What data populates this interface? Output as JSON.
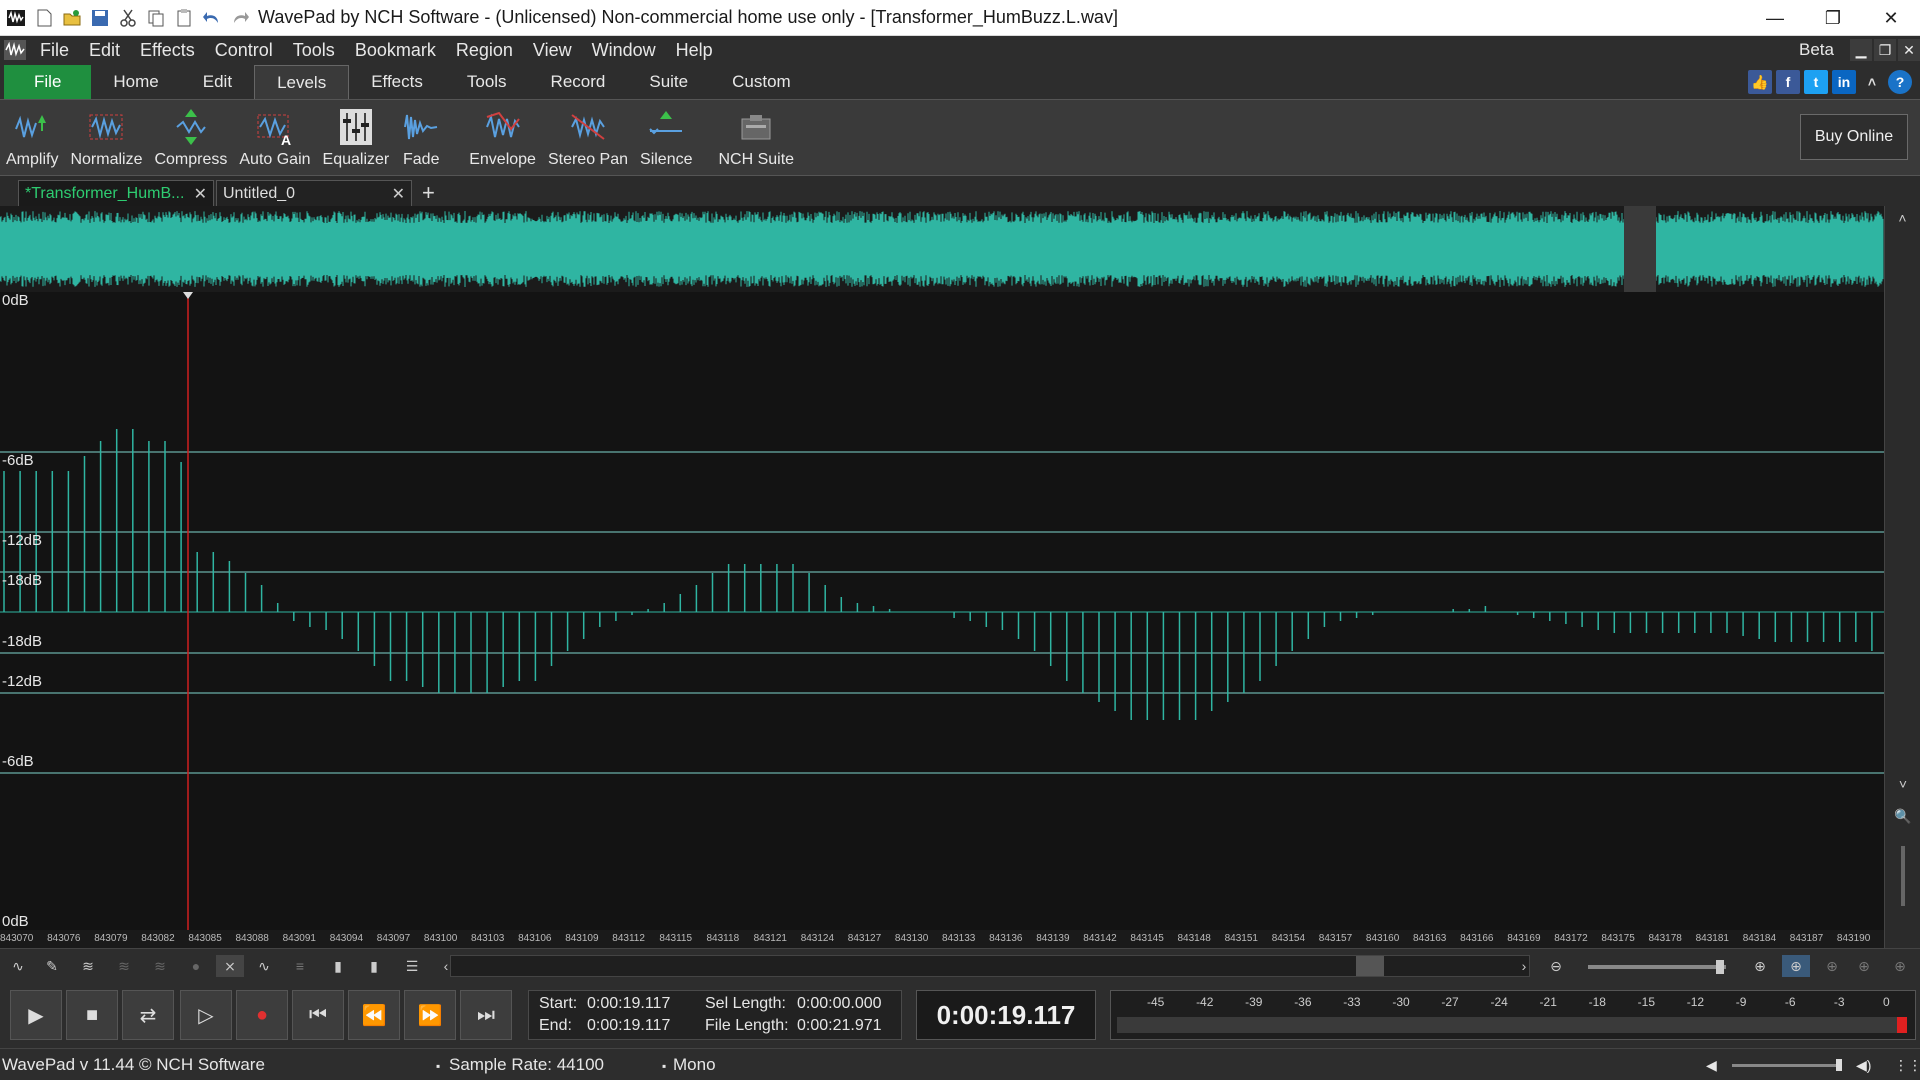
{
  "window": {
    "title": "WavePad by NCH Software - (Unlicensed) Non-commercial home use only - [Transformer_HumBuzz.L.wav]",
    "minimize": "—",
    "restore": "❐",
    "close": "✕"
  },
  "menu": {
    "items": [
      "File",
      "Edit",
      "Effects",
      "Control",
      "Tools",
      "Bookmark",
      "Region",
      "View",
      "Window",
      "Help"
    ],
    "beta": "Beta"
  },
  "ribbon_tabs": [
    "File",
    "Home",
    "Edit",
    "Levels",
    "Effects",
    "Tools",
    "Record",
    "Suite",
    "Custom"
  ],
  "active_ribbon_tab": "Levels",
  "toolbar": {
    "tools": [
      "Amplify",
      "Normalize",
      "Compress",
      "Auto Gain",
      "Equalizer",
      "Fade",
      "Envelope",
      "Stereo Pan",
      "Silence",
      "NCH Suite"
    ],
    "buy_online": "Buy Online"
  },
  "doc_tabs": [
    {
      "label": "*Transformer_HumB...",
      "active": true
    },
    {
      "label": "Untitled_0",
      "active": false
    }
  ],
  "db_labels": [
    "0dB",
    "-6dB",
    "-12dB",
    "-18dB",
    "-18dB",
    "-12dB",
    "-6dB",
    "0dB"
  ],
  "ruler_ticks": [
    "843070",
    "843076",
    "843079",
    "843082",
    "843085",
    "843088",
    "843091",
    "843094",
    "843097",
    "843100",
    "843103",
    "843106",
    "843109",
    "843112",
    "843115",
    "843118",
    "843121",
    "843124",
    "843127",
    "843130",
    "843133",
    "843136",
    "843139",
    "843142",
    "843145",
    "843148",
    "843151",
    "843154",
    "843157",
    "843160",
    "843163",
    "843166",
    "843169",
    "843172",
    "843175",
    "843178",
    "843181",
    "843184",
    "843187",
    "843190"
  ],
  "transport": {
    "start_label": "Start:",
    "start_value": "0:00:19.117",
    "end_label": "End:",
    "end_value": "0:00:19.117",
    "sel_length_label": "Sel Length:",
    "sel_length_value": "0:00:00.000",
    "file_length_label": "File Length:",
    "file_length_value": "0:00:21.971",
    "current_time": "0:00:19.117"
  },
  "meter_labels": [
    "-45",
    "-42",
    "-39",
    "-36",
    "-33",
    "-30",
    "-27",
    "-24",
    "-21",
    "-18",
    "-15",
    "-12",
    "-9",
    "-6",
    "-3",
    "0"
  ],
  "status": {
    "version": "WavePad v 11.44 © NCH Software",
    "sample_rate": "Sample Rate: 44100",
    "channels": "Mono"
  },
  "colors": {
    "waveform": "#2fb5a2",
    "cursor": "#d02020",
    "file_tab": "#1f8f3f"
  },
  "waveform_samples": [
    0.47,
    0.47,
    0.47,
    0.47,
    0.47,
    0.52,
    0.57,
    0.61,
    0.61,
    0.57,
    0.57,
    0.5,
    0.2,
    0.2,
    0.17,
    0.13,
    0.09,
    0.03,
    -0.03,
    -0.05,
    -0.06,
    -0.09,
    -0.13,
    -0.18,
    -0.23,
    -0.23,
    -0.25,
    -0.27,
    -0.27,
    -0.27,
    -0.27,
    -0.25,
    -0.23,
    -0.23,
    -0.18,
    -0.13,
    -0.09,
    -0.05,
    -0.03,
    -0.01,
    0.01,
    0.03,
    0.06,
    0.09,
    0.13,
    0.16,
    0.16,
    0.16,
    0.16,
    0.16,
    0.13,
    0.09,
    0.05,
    0.03,
    0.02,
    0.01,
    0.0,
    0.0,
    0.0,
    -0.02,
    -0.03,
    -0.05,
    -0.06,
    -0.09,
    -0.13,
    -0.18,
    -0.23,
    -0.27,
    -0.3,
    -0.33,
    -0.36,
    -0.36,
    -0.36,
    -0.36,
    -0.36,
    -0.33,
    -0.3,
    -0.27,
    -0.23,
    -0.18,
    -0.13,
    -0.09,
    -0.05,
    -0.03,
    -0.02,
    -0.01,
    0.0,
    0.0,
    0.0,
    0.0,
    0.01,
    0.01,
    0.02,
    0.0,
    -0.01,
    -0.02,
    -0.03,
    -0.04,
    -0.05,
    -0.06,
    -0.07,
    -0.07,
    -0.07,
    -0.07,
    -0.07,
    -0.07,
    -0.07,
    -0.07,
    -0.08,
    -0.09,
    -0.1,
    -0.1,
    -0.1,
    -0.1,
    -0.1,
    -0.1,
    -0.13
  ]
}
